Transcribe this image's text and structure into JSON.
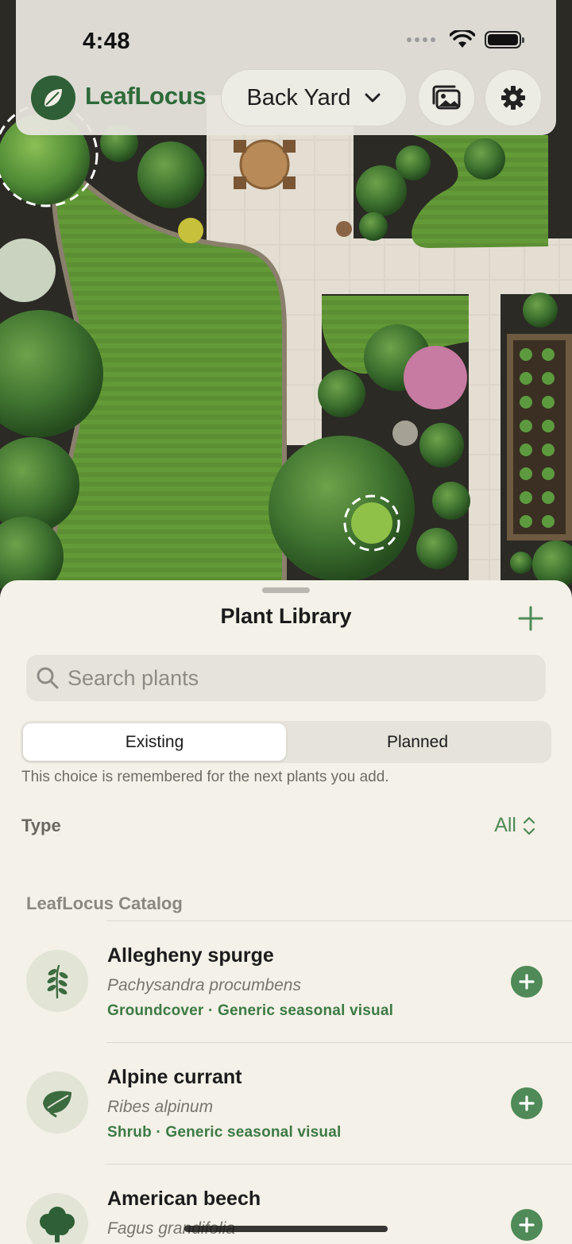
{
  "status_bar": {
    "time": "4:48"
  },
  "header": {
    "brand": "LeafLocus",
    "yard_selector": "Back Yard",
    "icons": [
      "leaf-icon",
      "chevron-down-icon",
      "photos-icon",
      "gear-icon"
    ]
  },
  "sheet": {
    "title": "Plant Library",
    "search": {
      "placeholder": "Search plants",
      "value": ""
    },
    "segments": {
      "existing": "Existing",
      "planned": "Planned",
      "selected": "Existing"
    },
    "hint": "This choice is remembered for the next plants you add.",
    "filter": {
      "label": "Type",
      "value": "All"
    },
    "section_title": "LeafLocus Catalog",
    "plants": [
      {
        "name": "Allegheny spurge",
        "scientific": "Pachysandra procumbens",
        "meta": "Groundcover · Generic seasonal visual",
        "icon": "fern-icon"
      },
      {
        "name": "Alpine currant",
        "scientific": "Ribes alpinum",
        "meta": "Shrub · Generic seasonal visual",
        "icon": "leaf-icon"
      },
      {
        "name": "American beech",
        "scientific": "Fagus grandifolia",
        "meta": "",
        "icon": "tree-icon"
      }
    ]
  },
  "colors": {
    "brand_green": "#2f6a3a",
    "accent_green": "#4f8a58",
    "sheet_bg": "#f4f1e8"
  }
}
